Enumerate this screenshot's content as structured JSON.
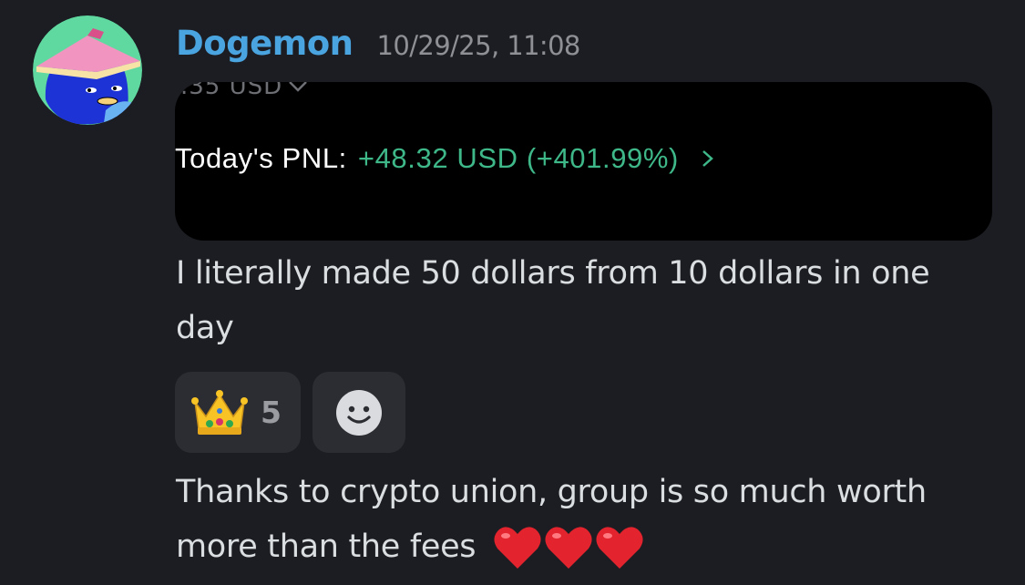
{
  "message": {
    "username": "Dogemon",
    "timestamp": "10/29/25, 11:08",
    "embed": {
      "balance_fragment": ".35 USD",
      "pnl_label": "Today's PNL:",
      "pnl_value": "+48.32 USD (+401.99%)"
    },
    "text_1": "I literally made 50 dollars from 10 dollars in one day",
    "reactions": [
      {
        "emoji": "crown-emoji",
        "count": "5"
      }
    ],
    "text_2": "Thanks to crypto union, group is so much worth more than the fees",
    "text_2_emoji": [
      "heart-emoji",
      "heart-emoji",
      "heart-emoji"
    ]
  },
  "colors": {
    "background": "#1c1d22",
    "username": "#4aa4e0",
    "timestamp": "#8e9096",
    "pnl_green": "#3fb889",
    "reaction_bg": "#2c2d33"
  }
}
